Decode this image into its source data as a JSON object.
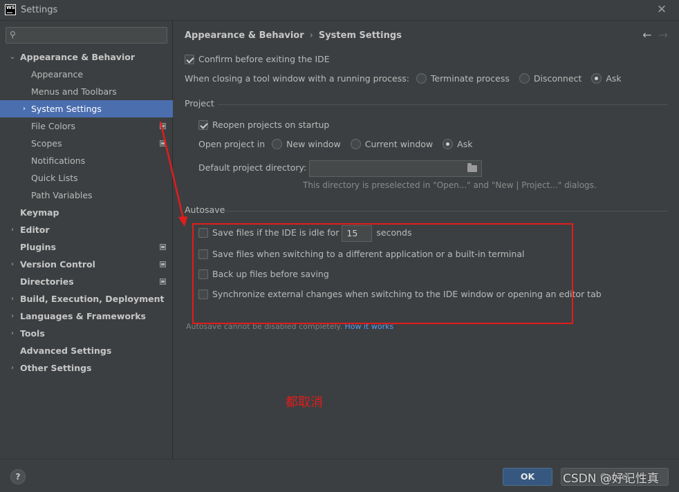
{
  "window": {
    "logo_text": "WS",
    "title": "Settings"
  },
  "search": {
    "placeholder": "",
    "value": ""
  },
  "sidebar": {
    "items": [
      {
        "label": "Appearance & Behavior",
        "level": 0,
        "expanded": true
      },
      {
        "label": "Appearance",
        "level": 1
      },
      {
        "label": "Menus and Toolbars",
        "level": 1
      },
      {
        "label": "System Settings",
        "level": 1,
        "selected": true
      },
      {
        "label": "File Colors",
        "level": 1
      },
      {
        "label": "Scopes",
        "level": 1
      },
      {
        "label": "Notifications",
        "level": 1
      },
      {
        "label": "Quick Lists",
        "level": 1
      },
      {
        "label": "Path Variables",
        "level": 1
      },
      {
        "label": "Keymap",
        "level": 0
      },
      {
        "label": "Editor",
        "level": 0
      },
      {
        "label": "Plugins",
        "level": 0
      },
      {
        "label": "Version Control",
        "level": 0
      },
      {
        "label": "Directories",
        "level": 0
      },
      {
        "label": "Build, Execution, Deployment",
        "level": 0
      },
      {
        "label": "Languages & Frameworks",
        "level": 0
      },
      {
        "label": "Tools",
        "level": 0
      },
      {
        "label": "Advanced Settings",
        "level": 0
      },
      {
        "label": "Other Settings",
        "level": 0
      }
    ]
  },
  "breadcrumb": {
    "parent": "Appearance & Behavior",
    "separator": "›",
    "current": "System Settings"
  },
  "general": {
    "confirm_exit": {
      "label": "Confirm before exiting the IDE",
      "checked": true
    },
    "closing_tool_window": {
      "label": "When closing a tool window with a running process:",
      "options": [
        "Terminate process",
        "Disconnect",
        "Ask"
      ],
      "selected": "Ask"
    }
  },
  "project": {
    "section_title": "Project",
    "reopen": {
      "label": "Reopen projects on startup",
      "checked": true
    },
    "open_project_in": {
      "label": "Open project in",
      "options": [
        "New window",
        "Current window",
        "Ask"
      ],
      "selected": "Ask"
    },
    "default_dir": {
      "label": "Default project directory:",
      "value": "",
      "hint": "This directory is preselected in \"Open...\" and \"New | Project...\" dialogs."
    }
  },
  "autosave": {
    "section_title": "Autosave",
    "idle": {
      "label_before": "Save files if the IDE is idle for",
      "value": "15",
      "label_after": "seconds",
      "checked": false
    },
    "switching": {
      "label": "Save files when switching to a different application or a built-in terminal",
      "checked": false
    },
    "backup": {
      "label": "Back up files before saving",
      "checked": false
    },
    "sync": {
      "label": "Synchronize external changes when switching to the IDE window or opening an editor tab",
      "checked": false
    },
    "footnote": "Autosave cannot be disabled completely.",
    "footnote_link": "How it works"
  },
  "annotation": {
    "text": "都取消",
    "color": "#e21c1c"
  },
  "buttons": {
    "help": "?",
    "ok": "OK",
    "cancel": "Cancel"
  },
  "watermark": "CSDN @好记性真"
}
